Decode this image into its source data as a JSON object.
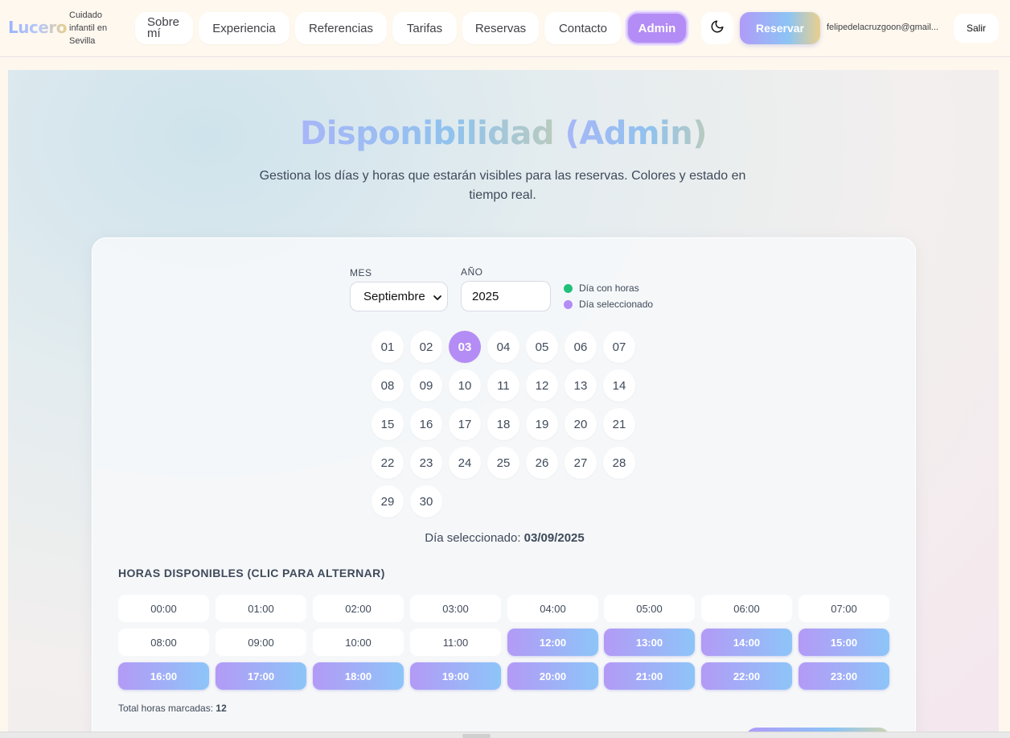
{
  "header": {
    "logo": "Lucero",
    "tagline": "Cuidado infantil en Sevilla",
    "nav": [
      {
        "label": "Sobre mí"
      },
      {
        "label": "Experiencia"
      },
      {
        "label": "Referencias"
      },
      {
        "label": "Tarifas"
      },
      {
        "label": "Reservas"
      },
      {
        "label": "Contacto"
      },
      {
        "label": "Admin"
      }
    ],
    "theme_icon": "moon-icon",
    "reserve_label": "Reservar",
    "user_email": "felipedelacruzgoon@gmail...",
    "logout_label": "Salir"
  },
  "page": {
    "title_main": "Disponibilidad",
    "title_suffix": "(Admin)",
    "subtitle": "Gestiona los días y horas que estarán visibles para las reservas. Colores y estado en tiempo real."
  },
  "filters": {
    "month_label": "MES",
    "month_value": "Septiembre",
    "year_label": "AÑO",
    "year_value": "2025"
  },
  "legend": [
    {
      "label": "Día con horas",
      "color": "#22c07a"
    },
    {
      "label": "Día seleccionado",
      "color": "#b48cf5"
    }
  ],
  "calendar": {
    "days": [
      "01",
      "02",
      "03",
      "04",
      "05",
      "06",
      "07",
      "08",
      "09",
      "10",
      "11",
      "12",
      "13",
      "14",
      "15",
      "16",
      "17",
      "18",
      "19",
      "20",
      "21",
      "22",
      "23",
      "24",
      "25",
      "26",
      "27",
      "28",
      "29",
      "30"
    ],
    "selected_index": 2
  },
  "selection": {
    "prefix": "Día seleccionado:",
    "date": "03/09/2025"
  },
  "hours": {
    "title": "HORAS DISPONIBLES (CLIC PARA ALTERNAR)",
    "slots": [
      {
        "time": "00:00",
        "on": false
      },
      {
        "time": "01:00",
        "on": false
      },
      {
        "time": "02:00",
        "on": false
      },
      {
        "time": "03:00",
        "on": false
      },
      {
        "time": "04:00",
        "on": false
      },
      {
        "time": "05:00",
        "on": false
      },
      {
        "time": "06:00",
        "on": false
      },
      {
        "time": "07:00",
        "on": false
      },
      {
        "time": "08:00",
        "on": false
      },
      {
        "time": "09:00",
        "on": false
      },
      {
        "time": "10:00",
        "on": false
      },
      {
        "time": "11:00",
        "on": false
      },
      {
        "time": "12:00",
        "on": true
      },
      {
        "time": "13:00",
        "on": true
      },
      {
        "time": "14:00",
        "on": true
      },
      {
        "time": "15:00",
        "on": true
      },
      {
        "time": "16:00",
        "on": true
      },
      {
        "time": "17:00",
        "on": true
      },
      {
        "time": "18:00",
        "on": true
      },
      {
        "time": "19:00",
        "on": true
      },
      {
        "time": "20:00",
        "on": true
      },
      {
        "time": "21:00",
        "on": true
      },
      {
        "time": "22:00",
        "on": true
      },
      {
        "time": "23:00",
        "on": true
      }
    ],
    "total_label": "Total horas marcadas:",
    "total_value": "12"
  },
  "colors": {
    "accent": "#b48cf5",
    "accent_gradient_end": "#8dc5f8",
    "available_dot": "#22c07a"
  }
}
